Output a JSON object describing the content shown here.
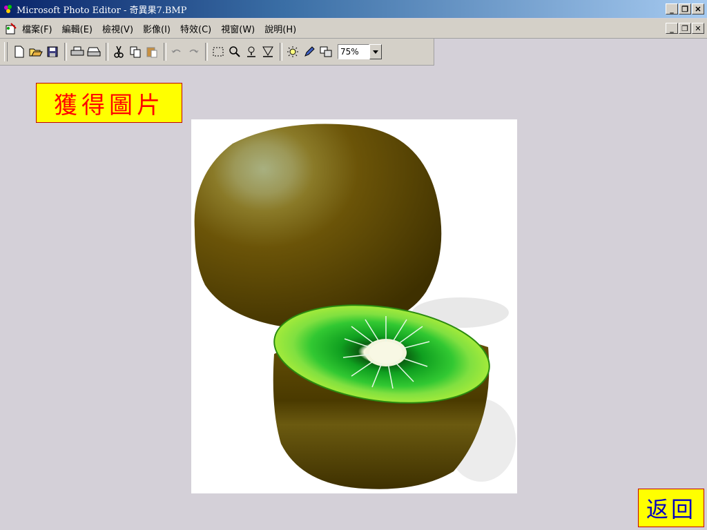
{
  "window": {
    "title": "Microsoft Photo Editor - 奇異果7.BMP"
  },
  "menu": {
    "items": [
      {
        "label": "檔案(F)"
      },
      {
        "label": "編輯(E)"
      },
      {
        "label": "檢視(V)"
      },
      {
        "label": "影像(I)"
      },
      {
        "label": "特效(C)"
      },
      {
        "label": "視窗(W)"
      },
      {
        "label": "說明(H)"
      }
    ]
  },
  "toolbar": {
    "icons": [
      "new-icon",
      "open-icon",
      "save-icon",
      "print-icon",
      "scan-icon",
      "cut-icon",
      "copy-icon",
      "paste-icon",
      "undo-icon",
      "redo-icon",
      "select-icon",
      "zoom-icon",
      "smudge-icon",
      "sharpen-icon",
      "balance-icon",
      "edit-icon",
      "properties-icon"
    ],
    "zoom_value": "75%"
  },
  "slide": {
    "caption": "獲得圖片",
    "back_label": "返回"
  },
  "colors": {
    "titlebar_start": "#0a246a",
    "caption_bg": "#ffff00",
    "caption_text": "#ff0000",
    "back_text": "#0000c0",
    "kiwi_skin": "#6b5408",
    "kiwi_flesh": "#32c832"
  }
}
